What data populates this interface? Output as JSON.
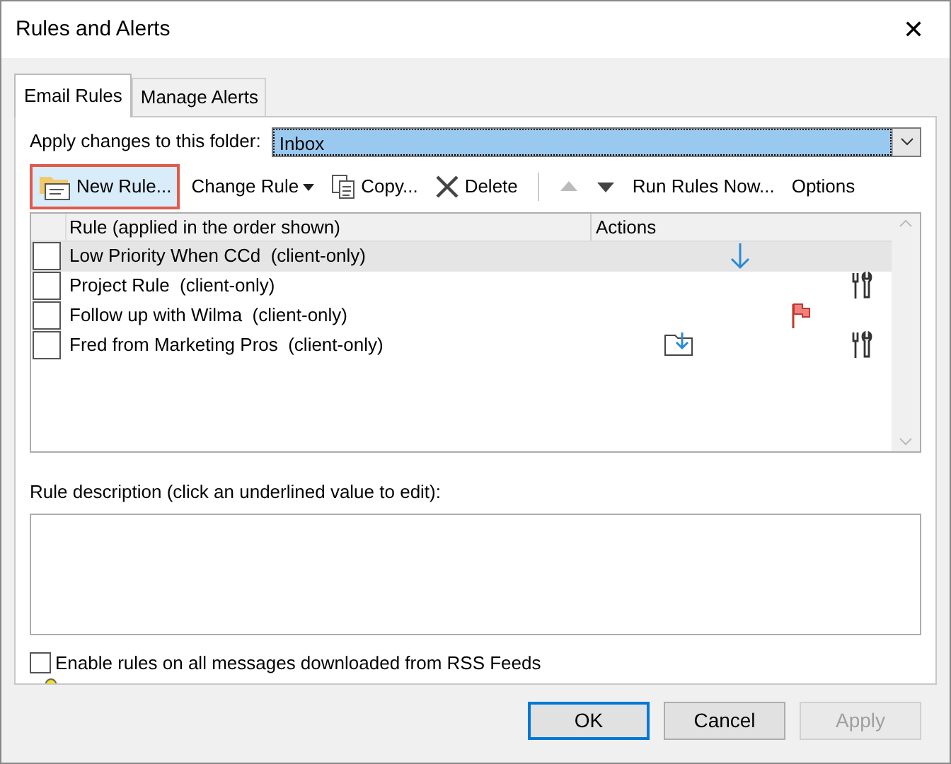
{
  "window": {
    "title": "Rules and Alerts",
    "close": "✕"
  },
  "tabs": [
    {
      "label": "Email Rules",
      "selected": true
    },
    {
      "label": "Manage Alerts",
      "selected": false
    }
  ],
  "folder": {
    "label": "Apply changes to this folder:",
    "value": "Inbox"
  },
  "toolbar": [
    {
      "kind": "new",
      "label": "New Rule...",
      "highlighted": true
    },
    {
      "kind": "change",
      "label": "Change Rule",
      "highlighted": false
    },
    {
      "kind": "copy",
      "label": "Copy...",
      "highlighted": false
    },
    {
      "kind": "delete",
      "label": "Delete",
      "highlighted": false
    },
    {
      "kind": "up",
      "disabled": true
    },
    {
      "kind": "down",
      "disabled": false
    },
    {
      "kind": "run",
      "label": "Run Rules Now...",
      "highlighted": false
    },
    {
      "kind": "options",
      "label": "Options",
      "highlighted": false
    }
  ],
  "table": {
    "columns": [
      "Rule (applied in the order shown)",
      "Actions"
    ],
    "rows": [
      {
        "name": "Low Priority When CCd  (client-only)",
        "checked": false,
        "selected": true,
        "actions": [
          {
            "kind": "arrow"
          }
        ]
      },
      {
        "name": "Project Rule  (client-only)",
        "checked": false,
        "selected": false,
        "actions": [
          {
            "kind": "tools"
          }
        ]
      },
      {
        "name": "Follow up with Wilma  (client-only)",
        "checked": false,
        "selected": false,
        "actions": [
          {
            "kind": "flag"
          }
        ]
      },
      {
        "name": "Fred from Marketing Pros  (client-only)",
        "checked": false,
        "selected": false,
        "actions": [
          {
            "kind": "folder"
          },
          {
            "kind": "tools"
          }
        ]
      }
    ]
  },
  "description": {
    "label": "Rule description (click an underlined value to edit):"
  },
  "rss": {
    "label": "Enable rules on all messages downloaded from RSS Feeds",
    "checked": false
  },
  "buttons": [
    {
      "label": "OK",
      "default": true,
      "disabled": false
    },
    {
      "label": "Cancel",
      "default": false,
      "disabled": false
    },
    {
      "label": "Apply",
      "default": false,
      "disabled": true
    }
  ]
}
